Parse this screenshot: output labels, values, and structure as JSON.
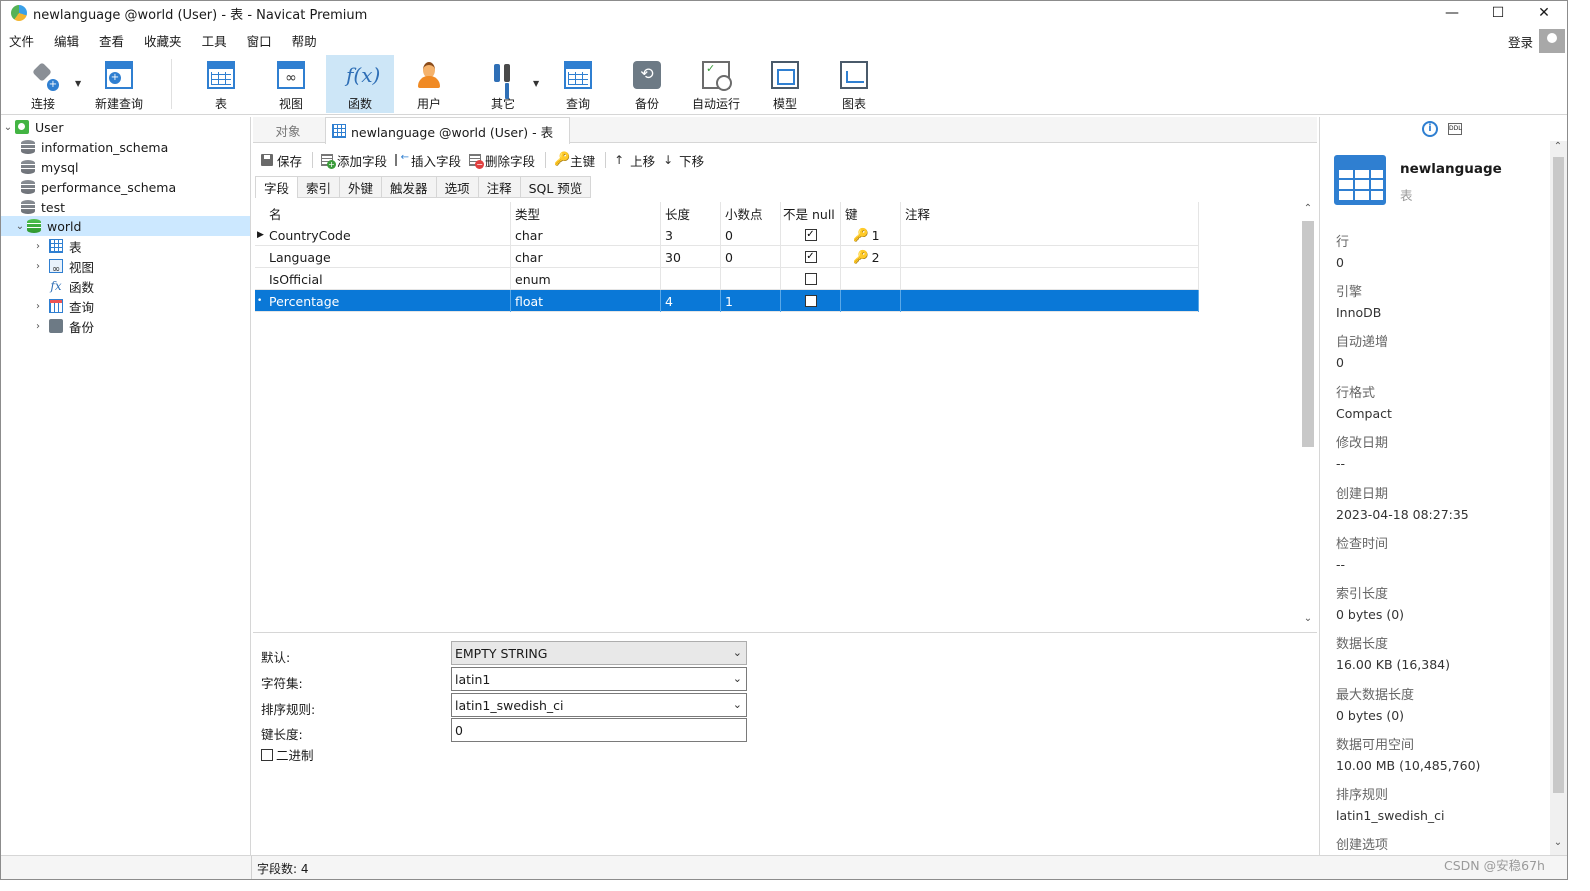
{
  "window": {
    "title": "newlanguage @world (User) - 表 - Navicat Premium",
    "controls": [
      "—",
      "☐",
      "✕"
    ]
  },
  "menu": [
    "文件",
    "编辑",
    "查看",
    "收藏夹",
    "工具",
    "窗口",
    "帮助"
  ],
  "login_label": "登录",
  "toolbar": [
    {
      "label": "连接",
      "icon": "connection-icon"
    },
    {
      "label": "新建查询",
      "icon": "new-query-icon"
    },
    {
      "label": "表",
      "icon": "table-icon"
    },
    {
      "label": "视图",
      "icon": "view-icon"
    },
    {
      "label": "函数",
      "icon": "function-icon"
    },
    {
      "label": "用户",
      "icon": "user-icon"
    },
    {
      "label": "其它",
      "icon": "tools-icon"
    },
    {
      "label": "查询",
      "icon": "query-icon"
    },
    {
      "label": "备份",
      "icon": "backup-icon"
    },
    {
      "label": "自动运行",
      "icon": "automation-icon"
    },
    {
      "label": "模型",
      "icon": "model-icon"
    },
    {
      "label": "图表",
      "icon": "chart-icon"
    }
  ],
  "tree": {
    "connection": "User",
    "databases": [
      "information_schema",
      "mysql",
      "performance_schema",
      "test",
      "world"
    ],
    "world_children": [
      "表",
      "视图",
      "函数",
      "查询",
      "备份"
    ]
  },
  "tabs": {
    "objects": "对象",
    "document": "newlanguage @world (User) - 表"
  },
  "actions": {
    "save": "保存",
    "add_field": "添加字段",
    "insert_field": "插入字段",
    "delete_field": "删除字段",
    "primary_key": "主键",
    "move_up": "上移",
    "move_down": "下移"
  },
  "subtabs": [
    "字段",
    "索引",
    "外键",
    "触发器",
    "选项",
    "注释",
    "SQL 预览"
  ],
  "grid": {
    "headers": [
      "名",
      "类型",
      "长度",
      "小数点",
      "不是 null",
      "键",
      "注释"
    ],
    "rows": [
      {
        "indicator": "▶",
        "name": "CountryCode",
        "type": "char",
        "length": "3",
        "decimals": "0",
        "not_null": "☑",
        "key": "1",
        "comment": ""
      },
      {
        "indicator": "",
        "name": "Language",
        "type": "char",
        "length": "30",
        "decimals": "0",
        "not_null": "☑",
        "key": "2",
        "comment": ""
      },
      {
        "indicator": "",
        "name": "IsOfficial",
        "type": "enum",
        "length": "",
        "decimals": "",
        "not_null": "☐",
        "key": "",
        "comment": ""
      },
      {
        "indicator": "•",
        "name": "Percentage",
        "type": "float",
        "length": "4",
        "decimals": "1",
        "not_null": "☐",
        "key": "",
        "comment": ""
      }
    ],
    "selected_row": 3
  },
  "properties": {
    "default_label": "默认:",
    "default_value": "EMPTY STRING",
    "charset_label": "字符集:",
    "charset_value": "latin1",
    "collation_label": "排序规则:",
    "collation_value": "latin1_swedish_ci",
    "keylen_label": "键长度:",
    "keylen_value": "0",
    "binary_label": "二进制"
  },
  "status": {
    "field_count": "字段数: 4"
  },
  "info_panel": {
    "name": "newlanguage",
    "kind": "表",
    "items": [
      {
        "label": "行",
        "value": "0"
      },
      {
        "label": "引擎",
        "value": "InnoDB"
      },
      {
        "label": "自动递增",
        "value": "0"
      },
      {
        "label": "行格式",
        "value": "Compact"
      },
      {
        "label": "修改日期",
        "value": "--"
      },
      {
        "label": "创建日期",
        "value": "2023-04-18 08:27:35"
      },
      {
        "label": "检查时间",
        "value": "--"
      },
      {
        "label": "索引长度",
        "value": "0 bytes (0)"
      },
      {
        "label": "数据长度",
        "value": "16.00 KB (16,384)"
      },
      {
        "label": "最大数据长度",
        "value": "0 bytes (0)"
      },
      {
        "label": "数据可用空间",
        "value": "10.00 MB (10,485,760)"
      },
      {
        "label": "排序规则",
        "value": "latin1_swedish_ci"
      },
      {
        "label": "创建选项",
        "value": ""
      }
    ]
  },
  "watermark": "CSDN @安稳67h",
  "colors": {
    "selection": "#0a78d7",
    "active_toolbar": "#cde6f7",
    "tree_selection": "#cce8ff",
    "accent": "#2f7fd1"
  }
}
